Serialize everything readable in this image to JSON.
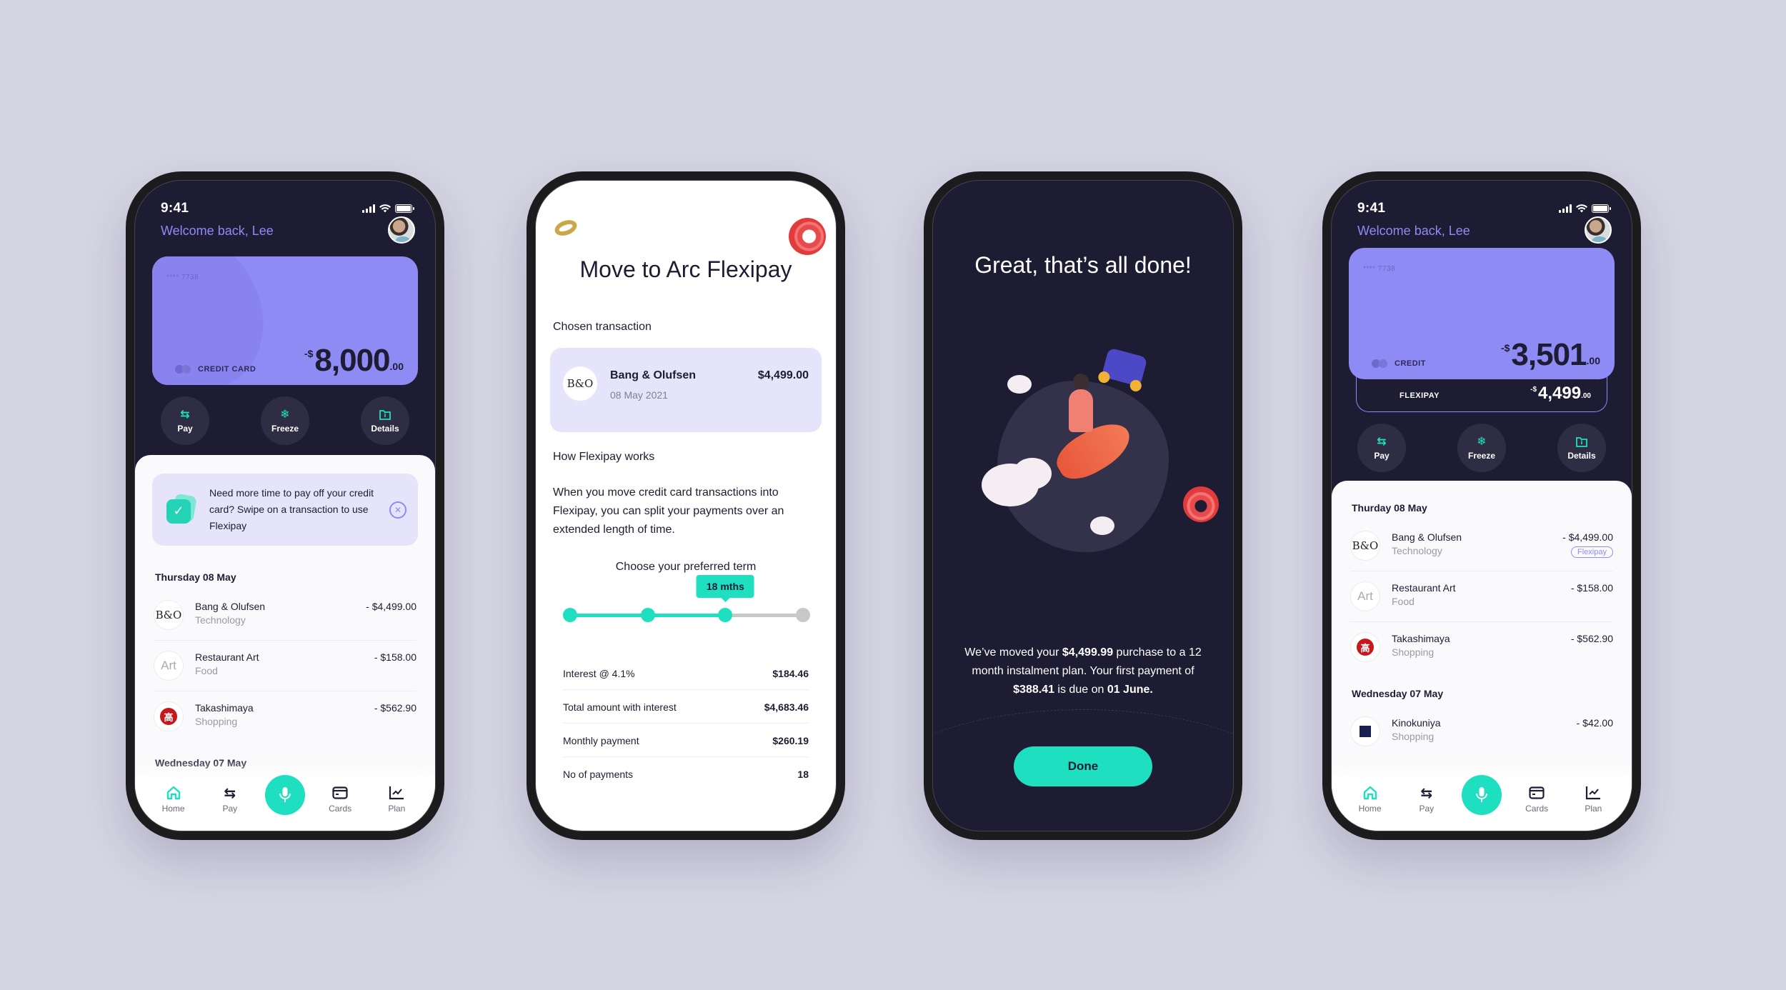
{
  "colors": {
    "background": "#d5d4e3",
    "dark_screen": "#1e1c33",
    "accent_purple": "#8e8bf5",
    "accent_teal": "#1ee0c0",
    "promo_bg": "#e6e4fb",
    "takashimaya_red": "#c8161d"
  },
  "status_bar": {
    "time": "9:41"
  },
  "home_screen_1": {
    "welcome": "Welcome back, Lee",
    "card": {
      "number": "**** 7738",
      "type_label": "CREDIT CARD",
      "amount_prefix": "-$",
      "amount_main": "8,000",
      "amount_cents": ".00"
    },
    "actions": [
      {
        "label": "Pay",
        "icon": "transfer-arrows-icon"
      },
      {
        "label": "Freeze",
        "icon": "snowflake-icon"
      },
      {
        "label": "Details",
        "icon": "folder-info-icon"
      }
    ],
    "promo": {
      "text": "Need more time to pay off your credit card? Swipe on a transaction to use Flexipay",
      "icon": "check-cards-icon",
      "close_icon": "close-circle-icon"
    },
    "groups": [
      {
        "date": "Thursday 08 May",
        "transactions": [
          {
            "name": "Bang & Olufsen",
            "category": "Technology",
            "amount": "- $4,499.00",
            "logo": "B&O"
          },
          {
            "name": "Restaurant Art",
            "category": "Food",
            "amount": "- $158.00",
            "logo": "Art"
          },
          {
            "name": "Takashimaya",
            "category": "Shopping",
            "amount": "- $562.90",
            "logo": "高"
          }
        ]
      },
      {
        "date": "Wednesday 07 May",
        "transactions": []
      }
    ]
  },
  "bottom_nav": {
    "items": [
      {
        "label": "Home",
        "icon": "home-icon",
        "active": true
      },
      {
        "label": "Pay",
        "icon": "transfer-arrows-icon",
        "active": false
      },
      {
        "label": "",
        "icon": "microphone-icon",
        "active": false
      },
      {
        "label": "Cards",
        "icon": "card-icon",
        "active": false
      },
      {
        "label": "Plan",
        "icon": "chart-line-icon",
        "active": false
      }
    ]
  },
  "flexipay_screen": {
    "title": "Move to Arc Flexipay",
    "chosen_label": "Chosen transaction",
    "chosen": {
      "name": "Bang & Olufsen",
      "date": "08 May 2021",
      "amount": "$4,499.00",
      "logo": "B&O"
    },
    "how_label": "How Flexipay works",
    "how_text": "When you move credit card transactions into Flexipay, you can split your payments over an extended length of time.",
    "term_label": "Choose your preferred term",
    "term": {
      "steps": 4,
      "selected_index": 2,
      "selected_label": "18 mths"
    },
    "summary": [
      {
        "label": "Interest @ 4.1%",
        "value": "$184.46"
      },
      {
        "label": "Total amount with interest",
        "value": "$4,683.46"
      },
      {
        "label": "Monthly payment",
        "value": "$260.19"
      },
      {
        "label": "No of payments",
        "value": "18"
      }
    ]
  },
  "done_screen": {
    "title": "Great, that’s all done!",
    "msg_1": "We’ve moved your ",
    "msg_amount": "$4,499.99",
    "msg_2": " purchase to a 12 month instalment plan. Your first payment of ",
    "msg_payment": "$388.41",
    "msg_3": " is due on ",
    "msg_date": "01 June.",
    "button": "Done"
  },
  "home_screen_2": {
    "welcome": "Welcome back, Lee",
    "card": {
      "number": "**** 7738",
      "type_label": "CREDIT",
      "amount_prefix": "-$",
      "amount_main": "3,501",
      "amount_cents": ".00"
    },
    "flexipay": {
      "label": "FLEXIPAY",
      "amount_prefix": "-$",
      "amount_main": "4,499",
      "amount_cents": ".00"
    },
    "actions": [
      {
        "label": "Pay",
        "icon": "transfer-arrows-icon"
      },
      {
        "label": "Freeze",
        "icon": "snowflake-icon"
      },
      {
        "label": "Details",
        "icon": "folder-info-icon"
      }
    ],
    "groups": [
      {
        "date": "Thurday 08 May",
        "transactions": [
          {
            "name": "Bang & Olufsen",
            "category": "Technology",
            "amount": "- $4,499.00",
            "badge": "Flexipay",
            "logo": "B&O"
          },
          {
            "name": "Restaurant Art",
            "category": "Food",
            "amount": "- $158.00",
            "logo": "Art"
          },
          {
            "name": "Takashimaya",
            "category": "Shopping",
            "amount": "- $562.90",
            "logo": "高"
          }
        ]
      },
      {
        "date": "Wednesday 07 May",
        "transactions": [
          {
            "name": "Kinokuniya",
            "category": "Shopping",
            "amount": "- $42.00",
            "logo": "K"
          }
        ]
      }
    ]
  }
}
